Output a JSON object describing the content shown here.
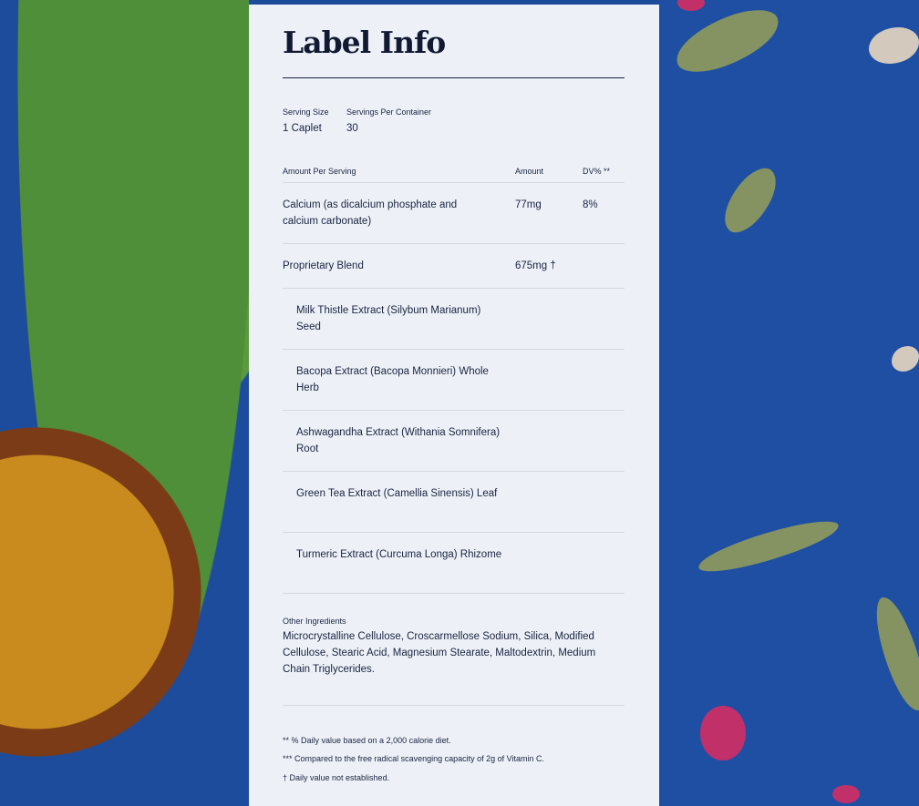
{
  "label": {
    "title": "Label Info",
    "serving_size_label": "Serving Size",
    "serving_size_value": "1 Caplet",
    "servings_per_container_label": "Servings Per Container",
    "servings_per_container_value": "30",
    "columns": {
      "amount_per_serving": "Amount Per Serving",
      "amount": "Amount",
      "dv": "DV% **"
    },
    "rows": [
      {
        "name": "Calcium (as dicalcium phosphate and calcium carbonate)",
        "amount": "77mg",
        "dv": "8%"
      },
      {
        "name": "Proprietary Blend",
        "amount": "675mg †",
        "dv": ""
      }
    ],
    "blend_ingredients": [
      "Milk Thistle Extract (Silybum Marianum) Seed",
      "Bacopa Extract (Bacopa Monnieri) Whole Herb",
      "Ashwagandha Extract (Withania Somnifera) Root",
      "Green Tea Extract (Camellia Sinensis) Leaf",
      "Turmeric Extract (Curcuma Longa) Rhizome"
    ],
    "other_ingredients_label": "Other Ingredients",
    "other_ingredients_value": "Microcrystalline Cellulose, Croscarmellose Sodium, Silica, Modified Cellulose, Stearic Acid, Magnesium Stearate, Maltodextrin, Medium Chain Triglycerides.",
    "footnotes": [
      "** % Daily value based on a 2,000 calorie diet.",
      "*** Compared to the free radical scavenging capacity of 2g of Vitamin C.",
      "† Daily value not established."
    ]
  },
  "colors": {
    "background_blue": "#1f4fa3",
    "panel": "#edf1f7",
    "text": "#1a2340"
  }
}
